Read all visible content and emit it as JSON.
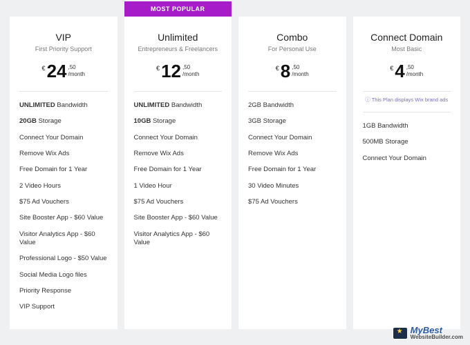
{
  "popular_ribbon": {
    "label": "MOST POPULAR",
    "color": "#a61cc9"
  },
  "plans": [
    {
      "name": "VIP",
      "subtitle": "First Priority Support",
      "currency": "€",
      "price_int": "24",
      "price_frac": ",50",
      "period": "/month",
      "features": [
        {
          "bold": "UNLIMITED",
          "rest": " Bandwidth"
        },
        {
          "bold": "20GB",
          "rest": " Storage"
        },
        {
          "text": "Connect Your Domain"
        },
        {
          "text": "Remove Wix Ads"
        },
        {
          "text": "Free Domain for 1 Year"
        },
        {
          "text": "2 Video Hours"
        },
        {
          "text": "$75 Ad Vouchers"
        },
        {
          "text": "Site Booster App - $60 Value"
        },
        {
          "text": "Visitor Analytics App - $60 Value"
        },
        {
          "text": "Professional Logo - $50 Value"
        },
        {
          "text": "Social Media Logo files"
        },
        {
          "text": "Priority Response"
        },
        {
          "text": "VIP Support"
        }
      ]
    },
    {
      "name": "Unlimited",
      "subtitle": "Entrepreneurs & Freelancers",
      "currency": "€",
      "price_int": "12",
      "price_frac": ",50",
      "period": "/month",
      "popular": true,
      "features": [
        {
          "bold": "UNLIMITED",
          "rest": " Bandwidth"
        },
        {
          "bold": "10GB",
          "rest": " Storage"
        },
        {
          "text": "Connect Your Domain"
        },
        {
          "text": "Remove Wix Ads"
        },
        {
          "text": "Free Domain for 1 Year"
        },
        {
          "text": "1 Video Hour"
        },
        {
          "text": "$75 Ad Vouchers"
        },
        {
          "text": "Site Booster App - $60 Value"
        },
        {
          "text": "Visitor Analytics App - $60 Value"
        }
      ]
    },
    {
      "name": "Combo",
      "subtitle": "For Personal Use",
      "currency": "€",
      "price_int": "8",
      "price_frac": ",50",
      "period": "/month",
      "features": [
        {
          "text": "2GB Bandwidth"
        },
        {
          "text": "3GB Storage"
        },
        {
          "text": "Connect Your Domain"
        },
        {
          "text": "Remove Wix Ads"
        },
        {
          "text": "Free Domain for 1 Year"
        },
        {
          "text": "30 Video Minutes"
        },
        {
          "text": "$75 Ad Vouchers"
        }
      ]
    },
    {
      "name": "Connect Domain",
      "subtitle": "Most Basic",
      "currency": "€",
      "price_int": "4",
      "price_frac": ",50",
      "period": "/month",
      "note": "ⓘ This Plan displays Wix brand ads",
      "features": [
        {
          "text": "1GB Bandwidth"
        },
        {
          "text": "500MB Storage"
        },
        {
          "text": "Connect Your Domain"
        }
      ]
    }
  ],
  "watermark": {
    "line1": "MyBest",
    "line2": "WebsiteBuilder.com"
  }
}
